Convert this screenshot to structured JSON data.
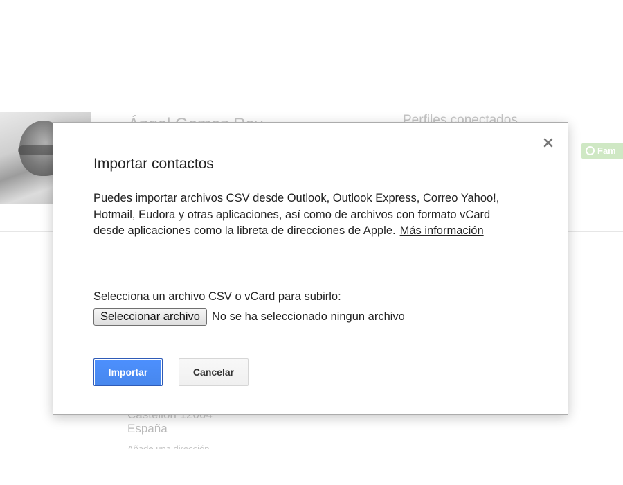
{
  "background": {
    "contact_name": "Ángel Gomez Rey",
    "connected_profiles_label": "Perfiles conectados",
    "badge_label": "Fam",
    "address_line": "Castellón 12004",
    "country": "España",
    "add_address_label": "Añade una dirección"
  },
  "dialog": {
    "title": "Importar contactos",
    "description": "Puedes importar archivos CSV desde Outlook, Outlook Express, Correo Yahoo!, Hotmail, Eudora y otras aplicaciones, así como de archivos con formato vCard desde aplicaciones como la libreta de direcciones de Apple.",
    "more_info_link": "Más información",
    "file_prompt": "Selecciona un archivo CSV o vCard para subirlo:",
    "choose_file_button": "Seleccionar archivo",
    "no_file_selected": "No se ha seleccionado ningun archivo",
    "import_button": "Importar",
    "cancel_button": "Cancelar",
    "close_icon": "close-icon"
  },
  "colors": {
    "primary_button": "#4d90fe",
    "badge_background": "#cfe8c4"
  }
}
